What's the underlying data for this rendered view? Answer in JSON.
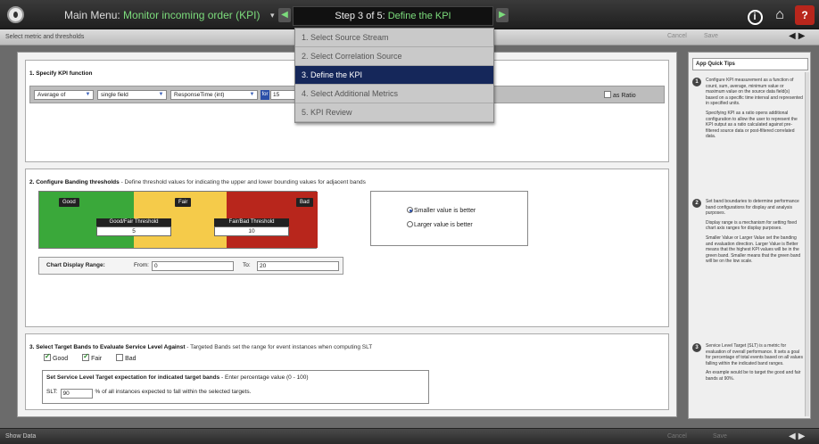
{
  "topbar": {
    "menu_prefix": "Main Menu:",
    "menu_value": "Monitor incoming order (KPI)",
    "step_prefix": "Step 3 of 5:",
    "step_value": "Define the KPI",
    "info_icon": "info-icon",
    "home_icon": "home-icon",
    "help_label": "?"
  },
  "subbar": {
    "label": "Select metric and thresholds",
    "cancel": "Cancel",
    "save": "Save"
  },
  "steps": [
    {
      "label": "1. Select Source Stream"
    },
    {
      "label": "2. Select Correlation Source"
    },
    {
      "label": "3. Define the KPI"
    },
    {
      "label": "4. Select Additional Metrics"
    },
    {
      "label": "5. KPI Review"
    }
  ],
  "section1": {
    "title": "1. Specify KPI function",
    "function": "Average of",
    "field_mode": "single field",
    "field": "ResponseTime (int)",
    "for_label": "for",
    "for_value": "15",
    "ratio_label": "as Ratio"
  },
  "section2": {
    "title": "2. Configure Banding thresholds",
    "desc": " - Define threshold values for indicating the upper and lower bounding values for adjacent bands",
    "good": "Good",
    "fair": "Fair",
    "bad": "Bad",
    "good_fair_label": "Good/Fair Threshold",
    "good_fair_value": "5",
    "fair_bad_label": "Fair/Bad Threshold",
    "fair_bad_value": "10",
    "smaller_label": "Smaller value is better",
    "larger_label": "Larger value is better",
    "range_label": "Chart Display Range:",
    "from_label": "From:",
    "from_value": "0",
    "to_label": "To:",
    "to_value": "20",
    "colors": {
      "good": "#3aa83a",
      "fair": "#f5cb4a",
      "bad": "#b8261c"
    }
  },
  "section3": {
    "title": "3. Select Target Bands to Evaluate Service Level Against",
    "desc": " - Targeted Bands set the range for event instances when computing SLT",
    "good": "Good",
    "fair": "Fair",
    "bad": "Bad",
    "slt_title": "Set Service Level Target expectation for indicated target bands",
    "slt_desc": " - Enter percentage value (0 - 100)",
    "slt_label": "SLT:",
    "slt_value": "90",
    "slt_suffix": "% of all instances expected to fall within the selected targets."
  },
  "tips": {
    "header": "App Quick Tips",
    "tip1": [
      "Configure KPI measurement as a function of count, sum, average, minimum value or maximum value on the source data field(s) based on a specific time interval and represented in specified units.",
      "Specifying KPI as a ratio opens additional configuration to allow the user to represent the KPI output as a ratio calculated against pre-filtered source data or post-filtered correlated data."
    ],
    "tip2": [
      "Set band boundaries to determine performance band configurations for display and analysis purposes.",
      "Display range is a mechanism for setting fixed chart axis ranges for display purposes.",
      "Smaller Value or Larger Value set the banding and evaluation direction. Larger Value is Better means that the highest KPI values will be in the green band. Smaller means that the green band will be on the low scale."
    ],
    "tip3": [
      "Service Level Target (SLT) is a metric for evaluation of overall performance. It sets a goal for percentage of total events based on all values falling within the indicated band ranges.",
      "An example would be to target the good and fair bands at 90%."
    ]
  },
  "bottombar": {
    "show_data": "Show Data",
    "cancel": "Cancel",
    "save": "Save"
  }
}
